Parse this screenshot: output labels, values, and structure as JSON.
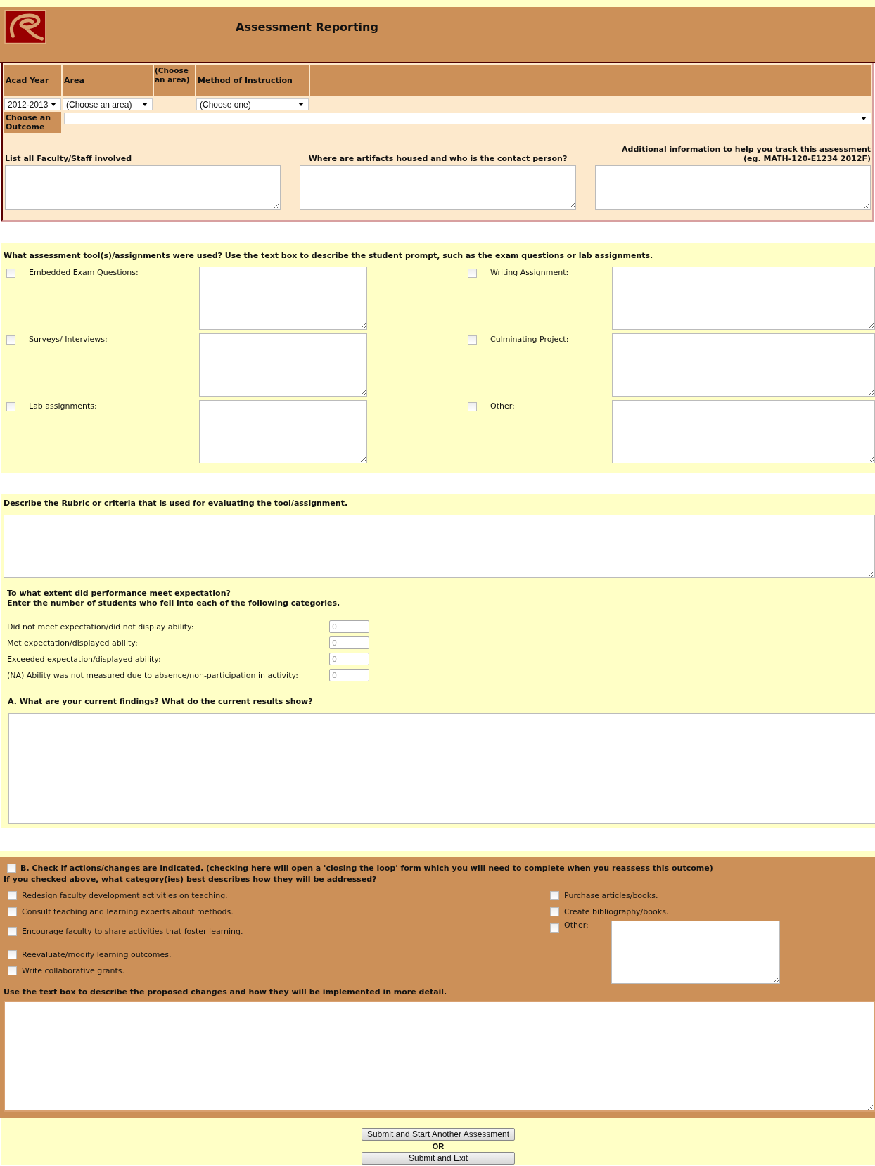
{
  "header": {
    "title": "Assessment Reporting"
  },
  "filters": {
    "columns": [
      "Acad Year",
      "Area",
      "(Choose an area)",
      "Method of Instruction"
    ],
    "year": "2012-2013",
    "area": "(Choose an area)",
    "method": "(Choose one)",
    "outcome_label": "Choose an Outcome"
  },
  "tracking": [
    {
      "lines": [
        "List all Faculty/Staff involved"
      ]
    },
    {
      "lines": [
        "Where are artifacts housed and who is the contact person?"
      ]
    },
    {
      "lines": [
        "Additional information to help you track this assessment",
        "(eg. MATH-120-E1234 2012F)"
      ]
    }
  ],
  "tools": {
    "prompt": "What assessment tool(s)/assignments were used? Use the text box to describe the student prompt, such as the exam questions or lab assignments.",
    "items": [
      {
        "label": "Embedded Exam Questions:",
        "checked": false
      },
      {
        "label": "Writing Assignment:",
        "checked": false
      },
      {
        "label": "Surveys/ Interviews:",
        "checked": false
      },
      {
        "label": "Culminating Project:",
        "checked": false
      },
      {
        "label": "Lab assignments:",
        "checked": false
      },
      {
        "label": "Other:",
        "checked": false
      }
    ]
  },
  "rubric": {
    "prompt": "Describe the Rubric or criteria that is used for evaluating the tool/assignment."
  },
  "performance": {
    "lines": [
      "To what extent did performance meet expectation?",
      "Enter the number of students who fell into each of the following categories."
    ],
    "rows": [
      {
        "label": "Did not meet expectation/did not display ability:",
        "value": "0"
      },
      {
        "label": "Met expectation/displayed ability:",
        "value": "0"
      },
      {
        "label": "Exceeded expectation/displayed ability:",
        "value": "0"
      },
      {
        "label": "(NA) Ability was not measured due to absence/non-participation in activity:",
        "value": "0"
      }
    ]
  },
  "findings": {
    "prompt": "A. What are your current findings? What do the current results show?"
  },
  "actions": {
    "check": {
      "label": "B. Check if actions/changes are indicated. (checking here will open a 'closing the loop' form which you will need to complete when you reassess this outcome)",
      "checked": false
    },
    "question": "If you checked above, what category(ies) best describes how they will be addressed?",
    "left": [
      {
        "label": "Redesign faculty development activities on teaching.",
        "checked": false
      },
      {
        "label": "Consult teaching and learning experts about methods.",
        "checked": false
      },
      {
        "label": "Encourage faculty to share activities that foster learning.",
        "checked": false
      },
      {
        "label": "Reevaluate/modify learning outcomes.",
        "checked": false
      },
      {
        "label": "Write collaborative grants.",
        "checked": false
      }
    ],
    "right": [
      {
        "label": "Purchase articles/books.",
        "checked": false
      },
      {
        "label": "Create bibliography/books.",
        "checked": false
      }
    ],
    "other": {
      "label": "Other:",
      "checked": false
    },
    "details_prompt": "Use the text box to describe the proposed changes and how they will be implemented in more detail."
  },
  "submit": {
    "buttons": [
      "Submit and Start Another Assessment",
      "Submit and Exit"
    ],
    "separator": "OR"
  }
}
